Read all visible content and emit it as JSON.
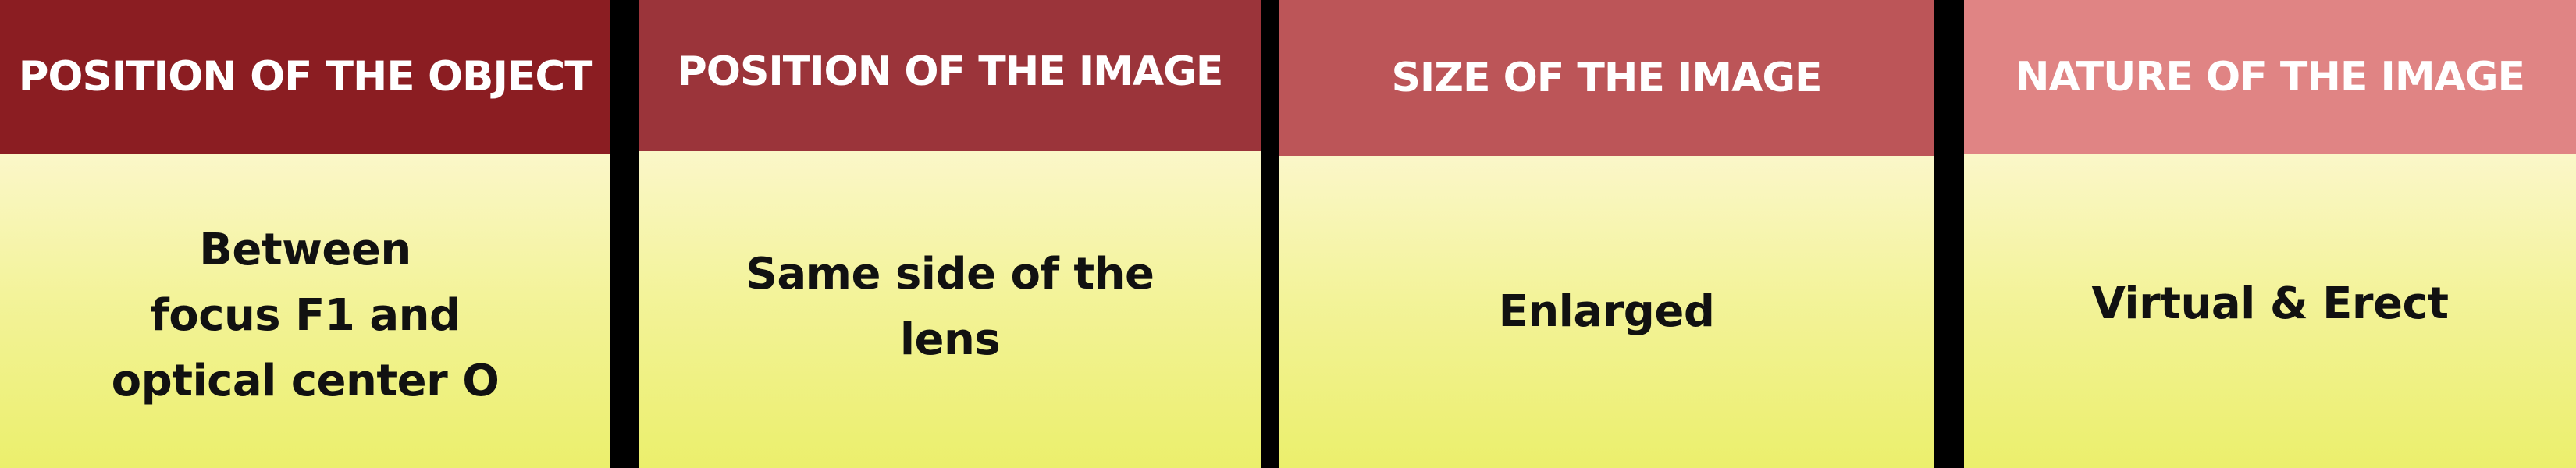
{
  "columns": [
    {
      "header": "POSITION OF THE OBJECT",
      "lines": [
        "Between",
        "focus F1 and",
        "optical center O"
      ],
      "header_color": "#8b1d22"
    },
    {
      "header": "POSITION OF THE IMAGE",
      "lines": [
        "Same side of the",
        "lens"
      ],
      "header_color": "#9b343a"
    },
    {
      "header": "SIZE OF THE IMAGE",
      "lines": [
        "Enlarged"
      ],
      "header_color": "#bc5558"
    },
    {
      "header": "NATURE OF THE IMAGE",
      "lines": [
        "Virtual & Erect"
      ],
      "header_color": "#e08484"
    }
  ],
  "colors": {
    "separator": "#000000",
    "body_gradient_top": "#fbf7c9",
    "body_gradient_bottom": "#ebef6c",
    "header_text": "#ffffff",
    "body_text": "#111111"
  }
}
